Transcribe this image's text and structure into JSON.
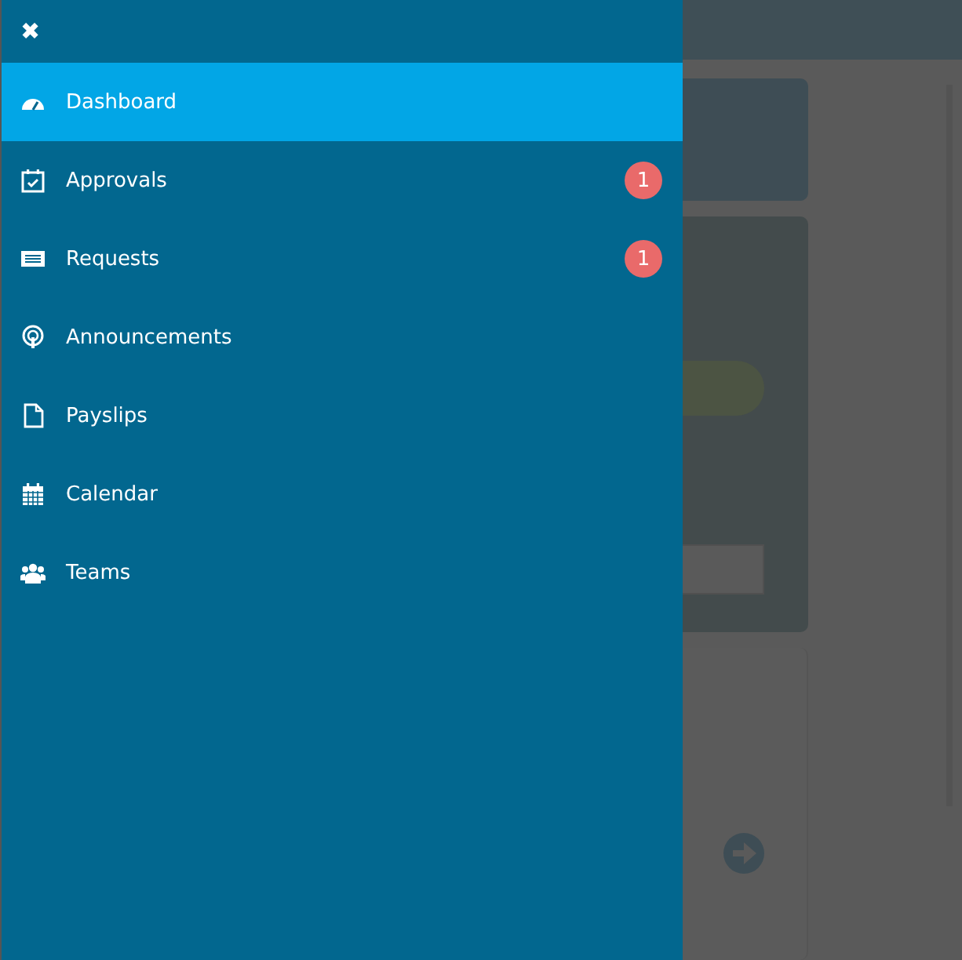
{
  "menu": {
    "close_icon": "✖",
    "items": [
      {
        "label": "Dashboard",
        "kind": "dashboard",
        "selected": true
      },
      {
        "label": "Approvals",
        "kind": "approvals",
        "selected": false,
        "badge": "1"
      },
      {
        "label": "Requests",
        "kind": "requests",
        "selected": false,
        "badge": "1"
      },
      {
        "label": "Announcements",
        "kind": "announcements",
        "selected": false
      },
      {
        "label": "Payslips",
        "kind": "payslips",
        "selected": false
      },
      {
        "label": "Calendar",
        "kind": "calendar",
        "selected": false
      },
      {
        "label": "Teams",
        "kind": "teams",
        "selected": false
      }
    ]
  }
}
